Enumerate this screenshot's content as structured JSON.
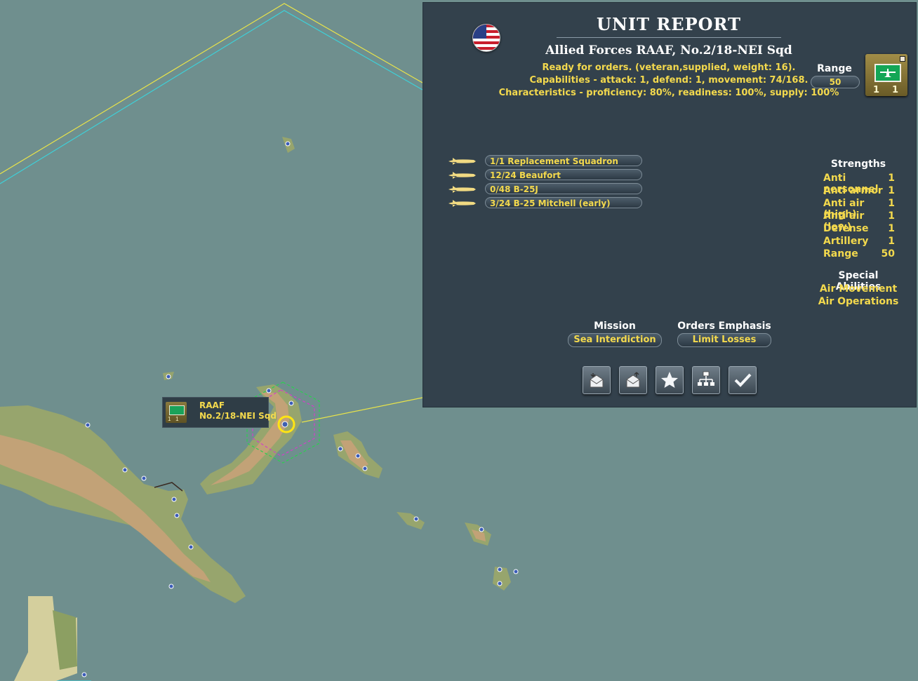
{
  "map": {
    "tooltip": {
      "line1": "RAAF",
      "line2": "No.2/18-NEI Sqd",
      "counter_attack": "1",
      "counter_defense": "1"
    },
    "colors": {
      "sea": "#6f8f8e",
      "land_green": "#97a56d",
      "land_tan": "#c2a277",
      "border_yellow": "#e8e34a",
      "border_cyan": "#3ed0d8"
    }
  },
  "report": {
    "title": "UNIT REPORT",
    "unit_name": "Allied Forces RAAF, No.2/18-NEI Sqd",
    "status_line": "Ready for orders. (veteran,supplied, weight: 16).",
    "capabilities_line": "Capabilities - attack: 1, defend: 1, movement: 74/168.",
    "characteristics_line": "Characteristics - proficiency: 80%, readiness: 100%, supply: 100%",
    "range_label": "Range",
    "range_value": "50",
    "counter": {
      "attack": "1",
      "defense": "1"
    },
    "aircraft": [
      {
        "label": "1/1 Replacement Squadron",
        "icon": "plane-icon"
      },
      {
        "label": "12/24 Beaufort",
        "icon": "plane-icon"
      },
      {
        "label": "0/48 B-25J",
        "icon": "plane-icon"
      },
      {
        "label": "3/24 B-25 Mitchell (early)",
        "icon": "plane-icon"
      }
    ],
    "strengths_title": "Strengths",
    "strengths": [
      {
        "name": "Anti personnel",
        "value": "1"
      },
      {
        "name": "Anti armor",
        "value": "1"
      },
      {
        "name": "Anti air (high)",
        "value": "1"
      },
      {
        "name": "Anti air (low)",
        "value": "1"
      },
      {
        "name": "Defense",
        "value": "1"
      },
      {
        "name": "Artillery",
        "value": "1"
      },
      {
        "name": "Range",
        "value": "50"
      }
    ],
    "special_title": "Special Abilities",
    "special": [
      "Air Movement",
      "Air Operations"
    ],
    "mission_label": "Mission",
    "mission_value": "Sea Interdiction",
    "orders_label": "Orders Emphasis",
    "orders_value": "Limit Losses",
    "buttons": [
      "inbox-icon",
      "send-mail-icon",
      "star-icon",
      "org-chart-icon",
      "checkmark-icon"
    ]
  }
}
